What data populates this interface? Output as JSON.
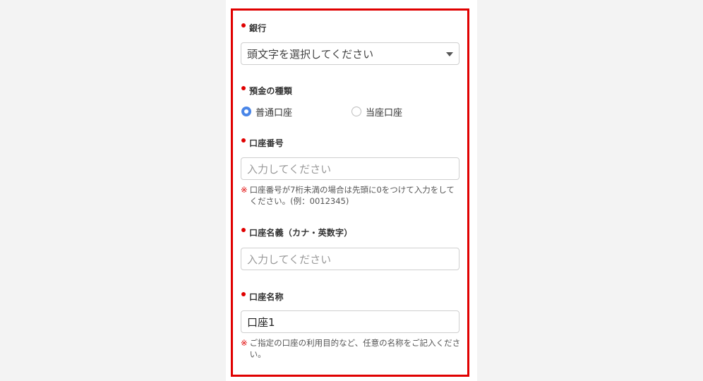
{
  "form": {
    "bank": {
      "label": "銀行",
      "select_placeholder": "頭文字を選択してください"
    },
    "deposit_type": {
      "label": "預金の種類",
      "options": [
        {
          "label": "普通口座",
          "selected": true
        },
        {
          "label": "当座口座",
          "selected": false
        }
      ]
    },
    "account_number": {
      "label": "口座番号",
      "placeholder": "入力してください",
      "value": "",
      "note_mark": "※",
      "note": "口座番号が7桁未満の場合は先頭に0をつけて入力をしてください。(例：0012345)"
    },
    "account_holder": {
      "label": "口座名義（カナ・英数字）",
      "placeholder": "入力してください",
      "value": ""
    },
    "account_nickname": {
      "label": "口座名称",
      "value": "口座1",
      "note_mark": "※",
      "note": "ご指定の口座の利用目的など、任意の名称をご記入ください。"
    }
  },
  "colors": {
    "required_dot": "#e00000",
    "frame_border": "#e00000",
    "radio_selected": "#4a86e8"
  }
}
